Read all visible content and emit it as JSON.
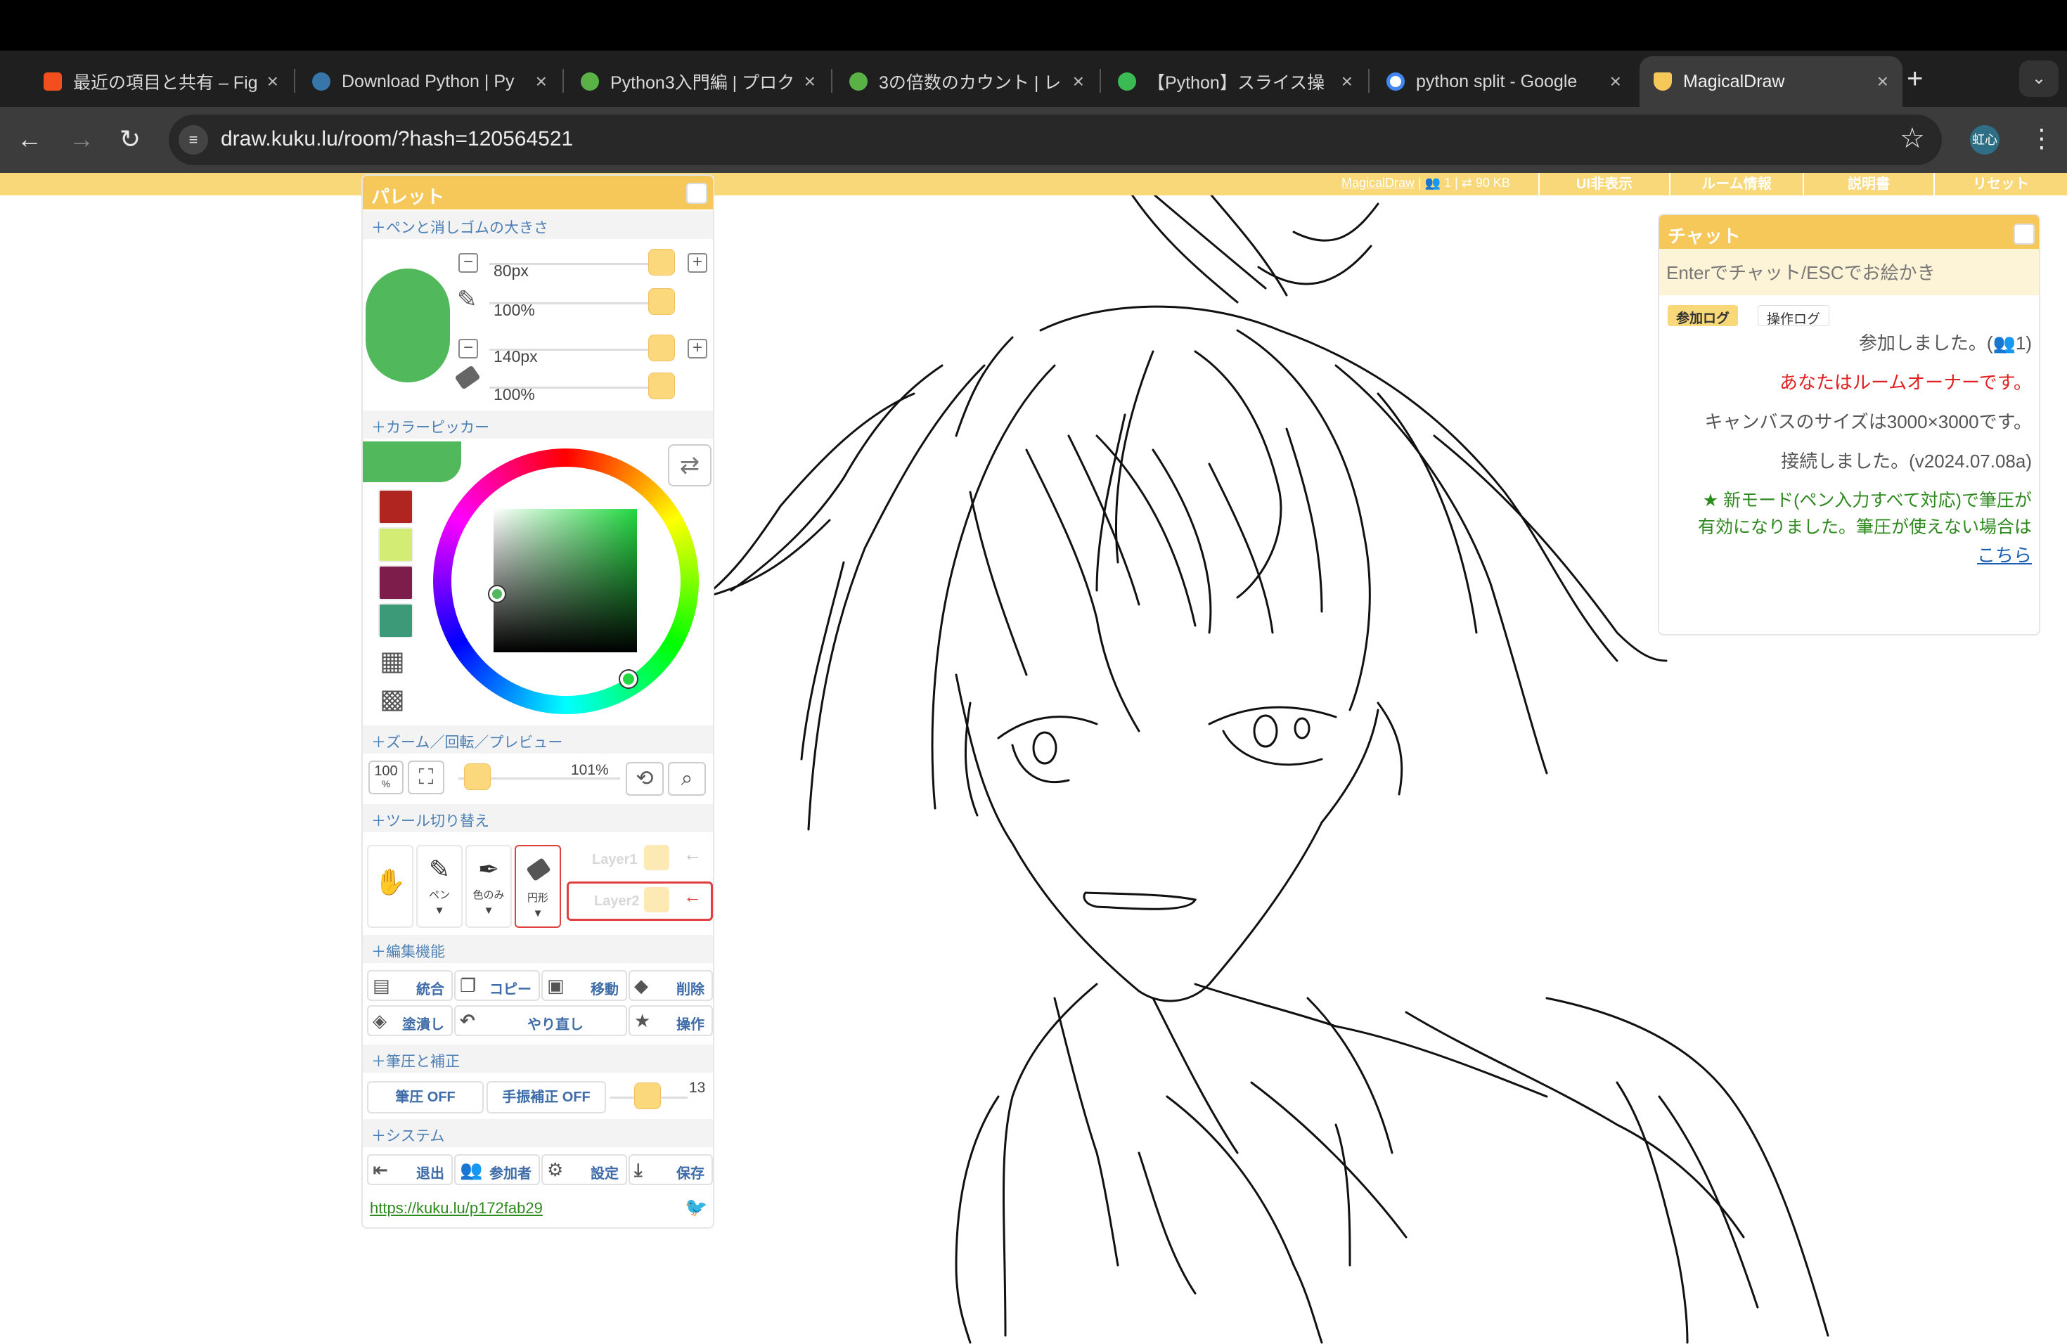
{
  "browser": {
    "tabs": [
      {
        "title": "最近の項目と共有 – Fig",
        "favicon": "figma-icon",
        "color": "#f24e1e"
      },
      {
        "title": "Download Python | Py",
        "favicon": "python-icon",
        "color": "#3776ab"
      },
      {
        "title": "Python3入門編 | プロク",
        "favicon": "progate-icon",
        "color": "#5ab246"
      },
      {
        "title": "3の倍数のカウント | レ",
        "favicon": "progate-icon",
        "color": "#5ab246"
      },
      {
        "title": "【Python】スライス操",
        "favicon": "site-icon",
        "color": "#3cba54"
      },
      {
        "title": "python split - Google",
        "favicon": "google-icon",
        "color": "#4285f4"
      },
      {
        "title": "MagicalDraw",
        "favicon": "rabbit-icon",
        "color": "#f6c85a",
        "active": true
      }
    ],
    "close_glyph": "×",
    "new_tab_glyph": "+",
    "tab_list_glyph": "⌄",
    "url": "draw.kuku.lu/room/?hash=120564521",
    "avatar_text": "虹心"
  },
  "app": {
    "info_link": "MagicalDraw",
    "info_text": " | 👥 1 | ⇄ 90 KB",
    "top_buttons": [
      "UI非表示",
      "ルーム情報",
      "説明書",
      "リセット"
    ],
    "accent": "#f6c85a",
    "strip_color": "#f8d878"
  },
  "palette": {
    "title": "パレット",
    "sections": {
      "size": "＋ペンと消しゴムの大きさ",
      "picker": "＋カラーピッカー",
      "zoom": "＋ズーム／回転／プレビュー",
      "tools": "＋ツール切り替え",
      "edit": "＋編集機能",
      "pressure": "＋筆圧と補正",
      "system": "＋システム"
    },
    "pen_color": "#52b85c",
    "pen_size": "80px",
    "pen_opacity": "100%",
    "eraser_size": "140px",
    "eraser_opacity": "100%",
    "swatches": [
      "#b0251f",
      "#d2ec74",
      "#7d1d4c",
      "#3d9a78"
    ],
    "zoom_value": "101%",
    "zoom_reset": "100",
    "zoom_reset_unit": "%",
    "tools": {
      "pen": "ペン",
      "eyedropper": "色のみ",
      "eraser": "円形",
      "caret": "▼"
    },
    "layers": [
      "Layer1",
      "Layer2"
    ],
    "edit_buttons": [
      "統合",
      "コピー",
      "移動",
      "削除",
      "塗潰し",
      "やり直し",
      "操作"
    ],
    "pressure_buttons": [
      "筆圧 OFF",
      "手振補正 OFF"
    ],
    "stabilizer_value": "13",
    "system_buttons": [
      "退出",
      "参加者",
      "設定",
      "保存"
    ],
    "link": "https://kuku.lu/p172fab29"
  },
  "chat": {
    "title": "チャット",
    "placeholder": "Enterでチャット/ESCでお絵かき",
    "tabs": [
      "参加ログ",
      "操作ログ"
    ],
    "messages": [
      {
        "text": "参加しました。(👥1)",
        "color": "#555555"
      },
      {
        "text": "あなたはルームオーナーです。",
        "color": "#e02020"
      },
      {
        "text": "キャンバスのサイズは3000×3000です。",
        "color": "#555555"
      },
      {
        "text": "接続しました。(v2024.07.08a)",
        "color": "#555555"
      },
      {
        "text": "★ 新モード(ペン入力すべて対応)で筆圧が",
        "color": "#2e8a1e"
      },
      {
        "text": "有効になりました。筆圧が使えない場合は",
        "color": "#2e8a1e"
      }
    ],
    "link": "こちら"
  }
}
